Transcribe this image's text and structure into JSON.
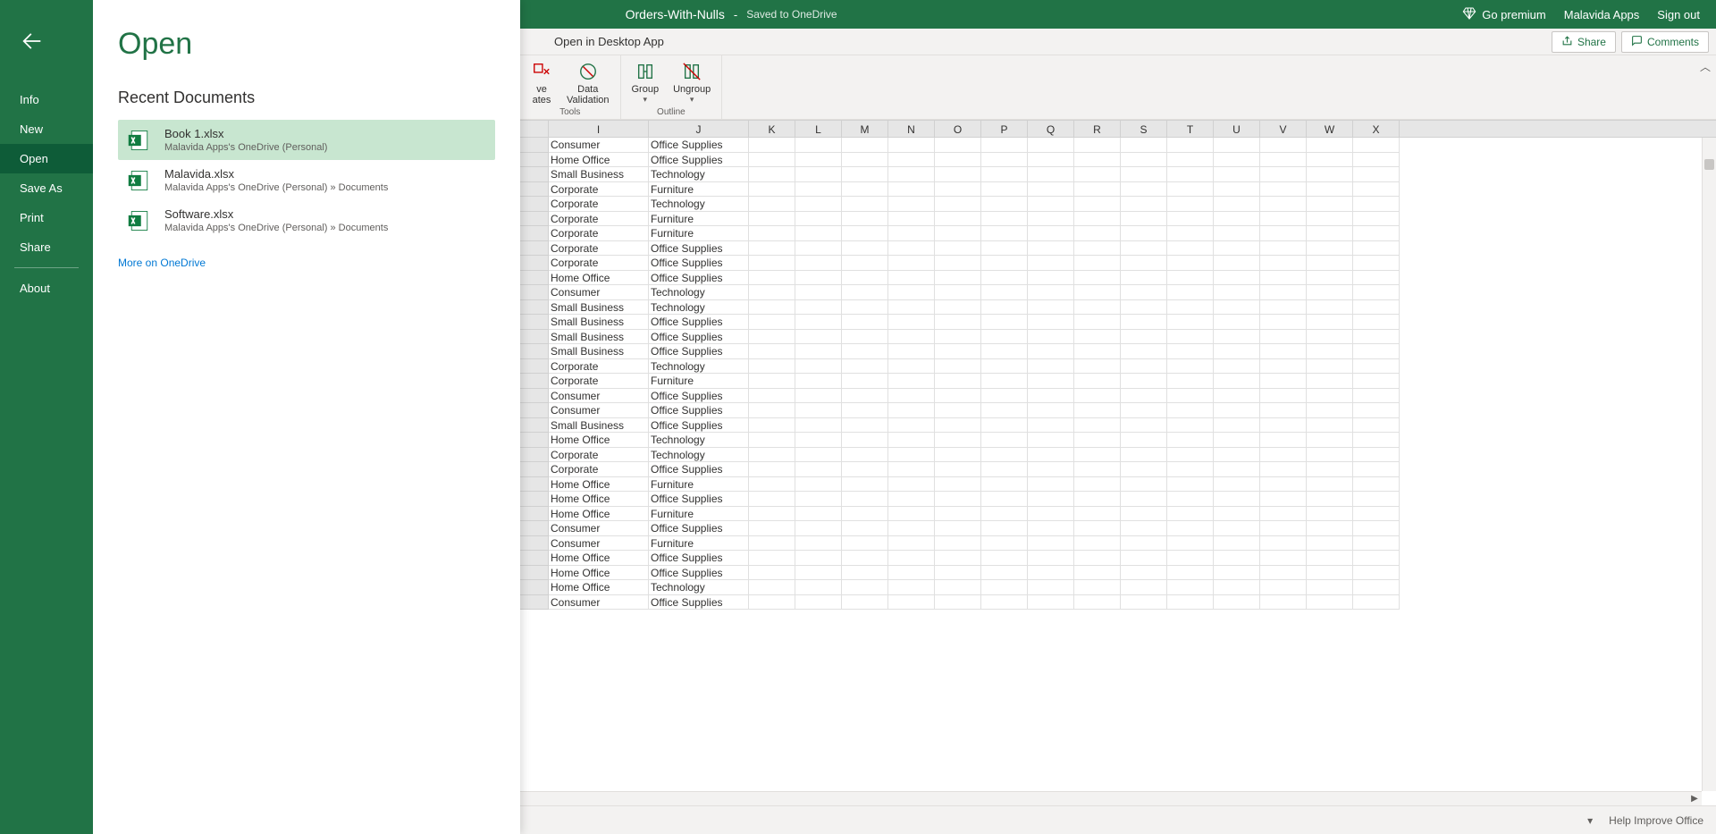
{
  "titlebar": {
    "doc_name": "Orders-With-Nulls",
    "dash": "-",
    "save_status": "Saved to OneDrive",
    "premium": "Go premium",
    "account": "Malavida Apps",
    "signout": "Sign out"
  },
  "tabsbar": {
    "open_desktop": "Open in Desktop App",
    "share": "Share",
    "comments": "Comments"
  },
  "ribbon": {
    "group1_items": [
      "ve",
      "Data",
      "ates",
      "Validation"
    ],
    "group1_partial_label1_a": "ve",
    "group1_partial_label1_b": "ates",
    "group1_data_label": "Data",
    "group1_validation_label": "Validation",
    "group1_label": "Tools",
    "group2_group": "Group",
    "group2_ungroup": "Ungroup",
    "group2_label": "Outline"
  },
  "backstage": {
    "title": "Open",
    "nav": [
      "Info",
      "New",
      "Open",
      "Save As",
      "Print",
      "Share",
      "About"
    ],
    "active_index": 2,
    "section_title": "Recent Documents",
    "recent": [
      {
        "name": "Book 1.xlsx",
        "path": "Malavida Apps's OneDrive (Personal)",
        "selected": true
      },
      {
        "name": "Malavida.xlsx",
        "path": "Malavida Apps's OneDrive (Personal) » Documents",
        "selected": false
      },
      {
        "name": "Software.xlsx",
        "path": "Malavida Apps's OneDrive (Personal) » Documents",
        "selected": false
      }
    ],
    "more_link": "More on OneDrive"
  },
  "columns": [
    "I",
    "J",
    "K",
    "L",
    "M",
    "N",
    "O",
    "P",
    "Q",
    "R",
    "S",
    "T",
    "U",
    "V",
    "W",
    "X"
  ],
  "rows": [
    {
      "i": "Consumer",
      "j": "Office Supplies"
    },
    {
      "i": "Home Office",
      "j": "Office Supplies"
    },
    {
      "i": "Small Business",
      "j": "Technology"
    },
    {
      "i": "Corporate",
      "j": "Furniture"
    },
    {
      "i": "Corporate",
      "j": "Technology"
    },
    {
      "i": "Corporate",
      "j": "Furniture"
    },
    {
      "i": "Corporate",
      "j": "Furniture"
    },
    {
      "i": "Corporate",
      "j": "Office Supplies"
    },
    {
      "i": "Corporate",
      "j": "Office Supplies"
    },
    {
      "i": "Home Office",
      "j": "Office Supplies"
    },
    {
      "i": "Consumer",
      "j": "Technology"
    },
    {
      "i": "Small Business",
      "j": "Technology"
    },
    {
      "i": "Small Business",
      "j": "Office Supplies"
    },
    {
      "i": "Small Business",
      "j": "Office Supplies"
    },
    {
      "i": "Small Business",
      "j": "Office Supplies"
    },
    {
      "i": "Corporate",
      "j": "Technology"
    },
    {
      "i": "Corporate",
      "j": "Furniture"
    },
    {
      "i": "Consumer",
      "j": "Office Supplies"
    },
    {
      "i": "Consumer",
      "j": "Office Supplies"
    },
    {
      "i": "Small Business",
      "j": "Office Supplies"
    },
    {
      "i": "Home Office",
      "j": "Technology"
    },
    {
      "i": "Corporate",
      "j": "Technology"
    },
    {
      "i": "Corporate",
      "j": "Office Supplies"
    },
    {
      "i": "Home Office",
      "j": "Furniture"
    },
    {
      "i": "Home Office",
      "j": "Office Supplies"
    },
    {
      "i": "Home Office",
      "j": "Furniture"
    },
    {
      "i": "Consumer",
      "j": "Office Supplies"
    },
    {
      "i": "Consumer",
      "j": "Furniture"
    },
    {
      "i": "Home Office",
      "j": "Office Supplies"
    },
    {
      "i": "Home Office",
      "j": "Office Supplies"
    },
    {
      "i": "Home Office",
      "j": "Technology"
    },
    {
      "i": "Consumer",
      "j": "Office Supplies"
    }
  ],
  "statusbar": {
    "help": "Help Improve Office"
  }
}
